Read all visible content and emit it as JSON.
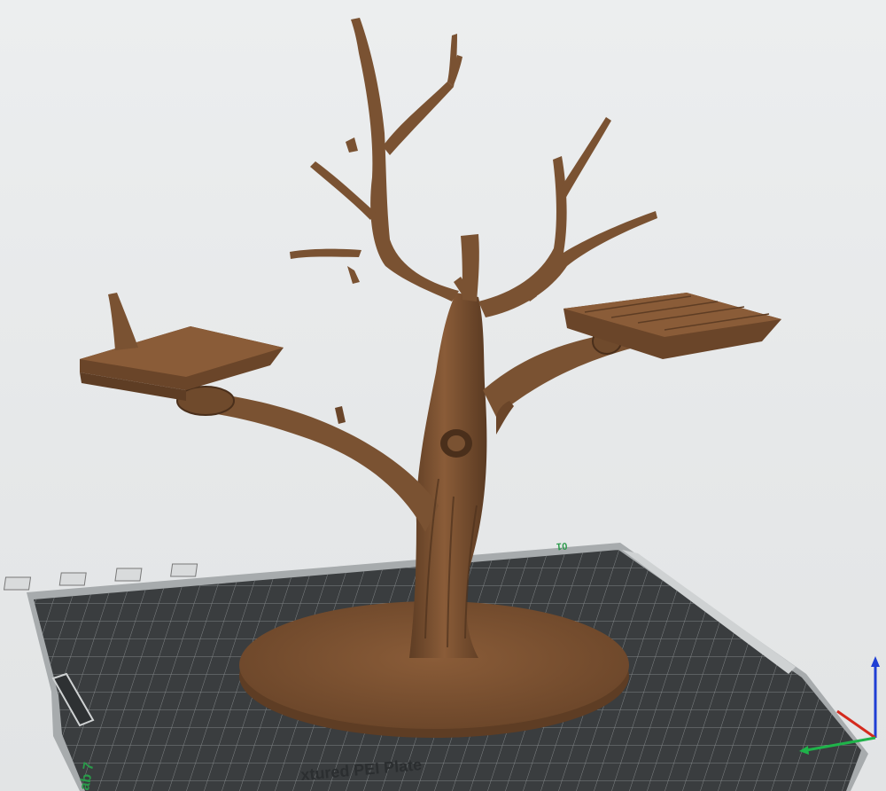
{
  "viewport": {
    "background": "#e8eaeb",
    "model_name": "tree-model"
  },
  "plate": {
    "name": "Textured PEI Plate",
    "name_visible": "xtured PEI Plate",
    "plate_number": "01",
    "label_left": "ab 7",
    "grid_color": "#7a7e80",
    "surface_color": "#3a3d3f",
    "frame_color": "#a9adaf",
    "icons": [
      "close-icon",
      "arrange-icon",
      "grid-icon",
      "orient-icon",
      "settings-icon"
    ]
  },
  "model": {
    "color": "#7a5232",
    "shadow_color": "#5a3b22",
    "highlight_color": "#9b6b43"
  },
  "axes": {
    "x_color": "#d42a1e",
    "y_color": "#1fb34a",
    "z_color": "#1f3fd4"
  }
}
